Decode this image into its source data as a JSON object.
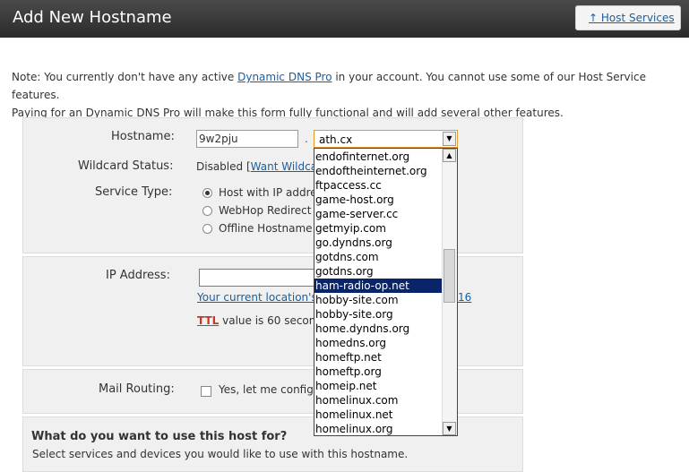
{
  "header": {
    "title": "Add New Hostname",
    "host_services_link": "↑ Host Services"
  },
  "note": {
    "part1": "Note: You currently don't have any active ",
    "link": "Dynamic DNS Pro",
    "part2": " in your account. You cannot use some of our Host Service features.",
    "line2": "Paying for an Dynamic DNS Pro will make this form fully functional and will add several other features."
  },
  "form": {
    "hostname_label": "Hostname:",
    "hostname_value": "9w2pju",
    "dot": ".",
    "domain_selected": "ath.cx",
    "wildcard_label": "Wildcard Status:",
    "wildcard_value": "Disabled [",
    "wildcard_link": "Want Wildca",
    "service_type_label": "Service Type:",
    "service_options": [
      "Host with IP addre",
      "WebHop Redirect [",
      "Offline Hostname ["
    ],
    "ip_label": "IP Address:",
    "current_location_link": "Your current location's",
    "ip_suffix": "16",
    "ttl_label": "TTL",
    "ttl_text": " value is 60 second",
    "mail_label": "Mail Routing:",
    "mail_option": "Yes, let me configu"
  },
  "usage": {
    "title": "What do you want to use this host for?",
    "subtitle": "Select services and devices you would like to use with this hostname."
  },
  "dropdown": {
    "items": [
      "endofinternet.org",
      "endoftheinternet.org",
      "ftpaccess.cc",
      "game-host.org",
      "game-server.cc",
      "getmyip.com",
      "go.dyndns.org",
      "gotdns.com",
      "gotdns.org",
      "ham-radio-op.net",
      "hobby-site.com",
      "hobby-site.org",
      "home.dyndns.org",
      "homedns.org",
      "homeftp.net",
      "homeftp.org",
      "homeip.net",
      "homelinux.com",
      "homelinux.net",
      "homelinux.org"
    ],
    "selected": "ham-radio-op.net"
  }
}
